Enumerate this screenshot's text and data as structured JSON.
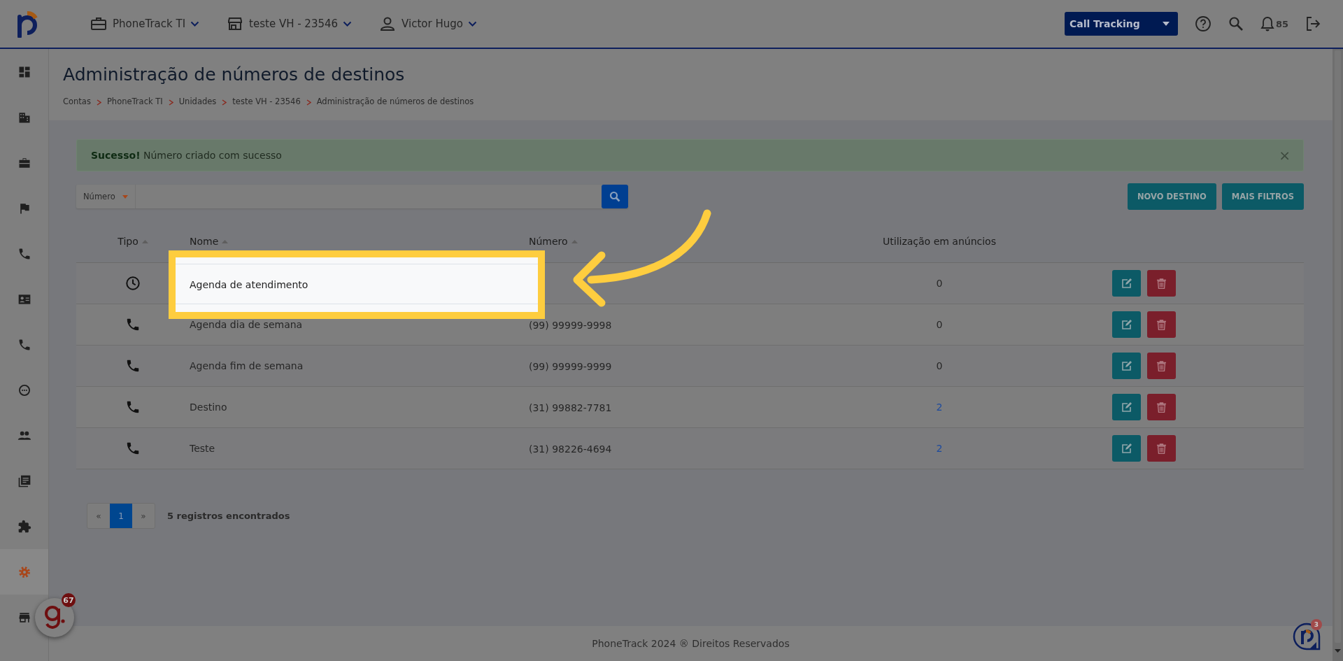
{
  "topbar": {
    "menus": [
      {
        "kind": "briefcase",
        "label": "PhoneTrack TI"
      },
      {
        "kind": "store",
        "label": "teste VH - 23546"
      },
      {
        "kind": "user",
        "label": "Victor Hugo"
      }
    ],
    "product_select": "Call Tracking",
    "notifications_count": "85"
  },
  "sidebar": {
    "items": [
      {
        "selected": false
      },
      {
        "selected": false
      },
      {
        "selected": false
      },
      {
        "selected": false
      },
      {
        "selected": false
      },
      {
        "selected": false
      },
      {
        "selected": false
      },
      {
        "selected": false
      },
      {
        "selected": false
      },
      {
        "selected": false
      },
      {
        "selected": false
      },
      {
        "selected": true
      },
      {
        "selected": false
      }
    ]
  },
  "page_title": "Administração de números de destinos",
  "breadcrumb": [
    "Contas",
    "PhoneTrack TI",
    "Unidades",
    "teste VH - 23546",
    "Administração de números de destinos"
  ],
  "alert": {
    "title": "Sucesso!",
    "message": "Número criado com sucesso",
    "close": "×"
  },
  "search": {
    "filter": "Número"
  },
  "buttons": [
    "NOVO DESTINO",
    "MAIS FILTROS"
  ],
  "table": {
    "columns": [
      {
        "label": "Tipo",
        "sortable": true
      },
      {
        "label": "Nome",
        "sortable": true
      },
      {
        "label": "Número",
        "sortable": true
      },
      {
        "label": "Utilização em anúncios",
        "sortable": false
      }
    ],
    "rows": [
      {
        "kind": "schedule",
        "name": "Agenda de atendimento",
        "number": "",
        "usage": "0",
        "usage_link": false,
        "highlighted": true
      },
      {
        "kind": "phone",
        "name": "Agenda dia de semana",
        "number": "(99) 99999-9998",
        "usage": "0",
        "usage_link": false,
        "highlighted": false
      },
      {
        "kind": "phone",
        "name": "Agenda fim de semana",
        "number": "(99) 99999-9999",
        "usage": "0",
        "usage_link": false,
        "highlighted": false
      },
      {
        "kind": "phone",
        "name": "Destino",
        "number": "(31) 99882-7781",
        "usage": "2",
        "usage_link": true,
        "highlighted": false
      },
      {
        "kind": "phone",
        "name": "Teste",
        "number": "(31) 98226-4694",
        "usage": "2",
        "usage_link": true,
        "highlighted": false
      }
    ]
  },
  "pagination": {
    "prev": "«",
    "pages": [
      {
        "label": "1",
        "selected": true
      }
    ],
    "next": "»",
    "summary": "5 registros encontrados"
  },
  "footer": "PhoneTrack 2024 ® Direitos Reservados",
  "chat_widget": {
    "badge": "67"
  },
  "help_widget": {
    "badge": "3"
  }
}
